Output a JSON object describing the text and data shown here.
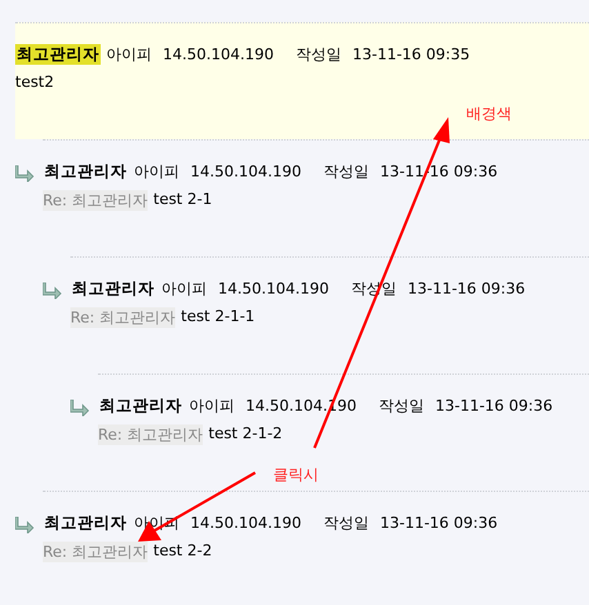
{
  "comments": [
    {
      "author": "최고관리자",
      "ip_label": "아이피",
      "ip": "14.50.104.190",
      "date_label": "작성일",
      "date": "13-11-16 09:35",
      "body": "test2",
      "highlighted": true,
      "children": [
        {
          "author": "최고관리자",
          "ip_label": "아이피",
          "ip": "14.50.104.190",
          "date_label": "작성일",
          "date": "13-11-16 09:36",
          "reply_to": "Re: 최고관리자",
          "body": "test 2-1",
          "highlighted": false,
          "children": [
            {
              "author": "최고관리자",
              "ip_label": "아이피",
              "ip": "14.50.104.190",
              "date_label": "작성일",
              "date": "13-11-16 09:36",
              "reply_to": "Re: 최고관리자",
              "body": "test 2-1-1",
              "highlighted": false,
              "children": [
                {
                  "author": "최고관리자",
                  "ip_label": "아이피",
                  "ip": "14.50.104.190",
                  "date_label": "작성일",
                  "date": "13-11-16 09:36",
                  "reply_to": "Re: 최고관리자",
                  "body": "test 2-1-2",
                  "highlighted": false
                }
              ]
            }
          ]
        },
        {
          "author": "최고관리자",
          "ip_label": "아이피",
          "ip": "14.50.104.190",
          "date_label": "작성일",
          "date": "13-11-16 09:36",
          "reply_to": "Re: 최고관리자",
          "body": "test 2-2",
          "highlighted": false
        }
      ]
    }
  ],
  "annotations": [
    {
      "text": "배경색"
    },
    {
      "text": "클릭시"
    }
  ]
}
